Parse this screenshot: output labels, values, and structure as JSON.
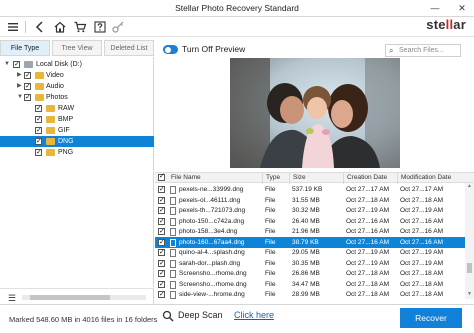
{
  "window": {
    "title": "Stellar Photo Recovery Standard",
    "minimize": "—",
    "close": "✕"
  },
  "toolbar": {
    "icons": [
      "hamburger-menu-icon",
      "back-icon",
      "home-icon",
      "cart-icon",
      "help-icon",
      "key-icon"
    ],
    "logo_prefix": "ste",
    "logo_mark": "ll",
    "logo_suffix": "ar"
  },
  "left_tabs": [
    {
      "label": "File Type",
      "active": true
    },
    {
      "label": "Tree View",
      "active": false
    },
    {
      "label": "Deleted List",
      "active": false
    }
  ],
  "tree": [
    {
      "label": "Local Disk (D:)",
      "checked": true,
      "expanded": true,
      "drive": true,
      "selected": false
    },
    {
      "label": "Video",
      "checked": true,
      "expanded": false,
      "drive": false,
      "selected": false
    },
    {
      "label": "Audio",
      "checked": true,
      "expanded": false,
      "drive": false,
      "selected": false
    },
    {
      "label": "Photos",
      "checked": true,
      "expanded": true,
      "drive": false,
      "selected": false
    },
    {
      "label": "RAW",
      "checked": true,
      "expanded": false,
      "drive": false,
      "selected": false
    },
    {
      "label": "BMP",
      "checked": true,
      "expanded": false,
      "drive": false,
      "selected": false
    },
    {
      "label": "GIF",
      "checked": true,
      "expanded": false,
      "drive": false,
      "selected": false
    },
    {
      "label": "DNG",
      "checked": true,
      "expanded": false,
      "drive": false,
      "selected": true
    },
    {
      "label": "PNG",
      "checked": true,
      "expanded": false,
      "drive": false,
      "selected": false
    }
  ],
  "preview": {
    "toggle_label": "Turn Off Preview",
    "toggle_on": true
  },
  "search": {
    "placeholder": "Search Files..."
  },
  "table": {
    "headers": [
      "File Name",
      "Type",
      "Size",
      "Creation Date",
      "Modification Date"
    ],
    "rows": [
      {
        "name": "pexels-ne...33999.dng",
        "type": "File",
        "size": "537.19 KB",
        "created": "Oct 27...17 AM",
        "modified": "Oct 27...17 AM",
        "selected": false
      },
      {
        "name": "pexels-ol...46111.dng",
        "type": "File",
        "size": "31.55 MB",
        "created": "Oct 27...18 AM",
        "modified": "Oct 27...18 AM",
        "selected": false
      },
      {
        "name": "pexels-th...721073.dng",
        "type": "File",
        "size": "30.32 MB",
        "created": "Oct 27...19 AM",
        "modified": "Oct 27...19 AM",
        "selected": false
      },
      {
        "name": "photo-150...c742a.dng",
        "type": "File",
        "size": "26.40 MB",
        "created": "Oct 27...16 AM",
        "modified": "Oct 27...16 AM",
        "selected": false
      },
      {
        "name": "photo-158...3e4.dng",
        "type": "File",
        "size": "21.96 MB",
        "created": "Oct 27...16 AM",
        "modified": "Oct 27...16 AM",
        "selected": false
      },
      {
        "name": "photo-160...67aa4.dng",
        "type": "File",
        "size": "38.79 KB",
        "created": "Oct 27...16 AM",
        "modified": "Oct 27...16 AM",
        "selected": true
      },
      {
        "name": "quino-al-4...splash.dng",
        "type": "File",
        "size": "29.05 MB",
        "created": "Oct 27...19 AM",
        "modified": "Oct 27...19 AM",
        "selected": false
      },
      {
        "name": "sarah-dor...plash.dng",
        "type": "File",
        "size": "30.35 MB",
        "created": "Oct 27...19 AM",
        "modified": "Oct 27...19 AM",
        "selected": false
      },
      {
        "name": "Screensho...rhome.dng",
        "type": "File",
        "size": "26.86 MB",
        "created": "Oct 27...18 AM",
        "modified": "Oct 27...18 AM",
        "selected": false
      },
      {
        "name": "Screensho...rhome.dng",
        "type": "File",
        "size": "34.47 MB",
        "created": "Oct 27...18 AM",
        "modified": "Oct 27...18 AM",
        "selected": false
      },
      {
        "name": "side-view-...hrome.dng",
        "type": "File",
        "size": "28.99 MB",
        "created": "Oct 27...18 AM",
        "modified": "Oct 27...18 AM",
        "selected": false
      }
    ]
  },
  "deep_scan": {
    "label": "Deep Scan",
    "link": "Click here"
  },
  "status": {
    "text": "Marked 548.60 MB in 4016 files in 16 folders"
  },
  "recover_button": {
    "label": "Recover"
  },
  "colors": {
    "accent": "#1080d8",
    "selection": "#0f84d6",
    "folder": "#e9b63c",
    "logo_red": "#c62828"
  }
}
